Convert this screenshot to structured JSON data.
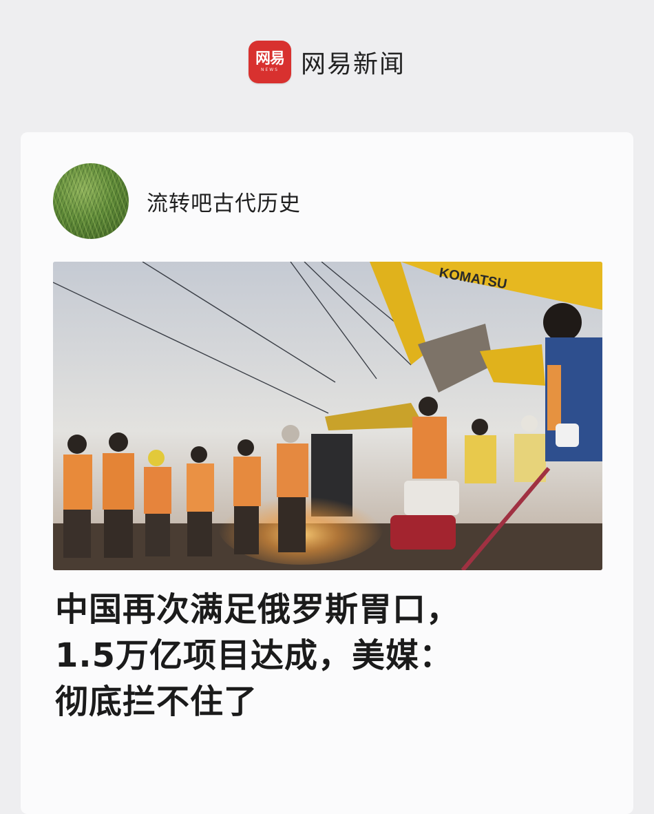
{
  "app": {
    "logo_text": "网易",
    "logo_sub": "NEWS",
    "name": "网易新闻"
  },
  "post": {
    "author": "流转吧古代历史",
    "image_sign": "KOMATSU",
    "headline": "中国再次满足俄罗斯胃口，\n1.5万亿项目达成，美媒：\n彻底拦不住了"
  },
  "colors": {
    "brand_red": "#d8312f",
    "excavator_yellow": "#e0b21c",
    "vest_orange": "#e88a3a"
  }
}
